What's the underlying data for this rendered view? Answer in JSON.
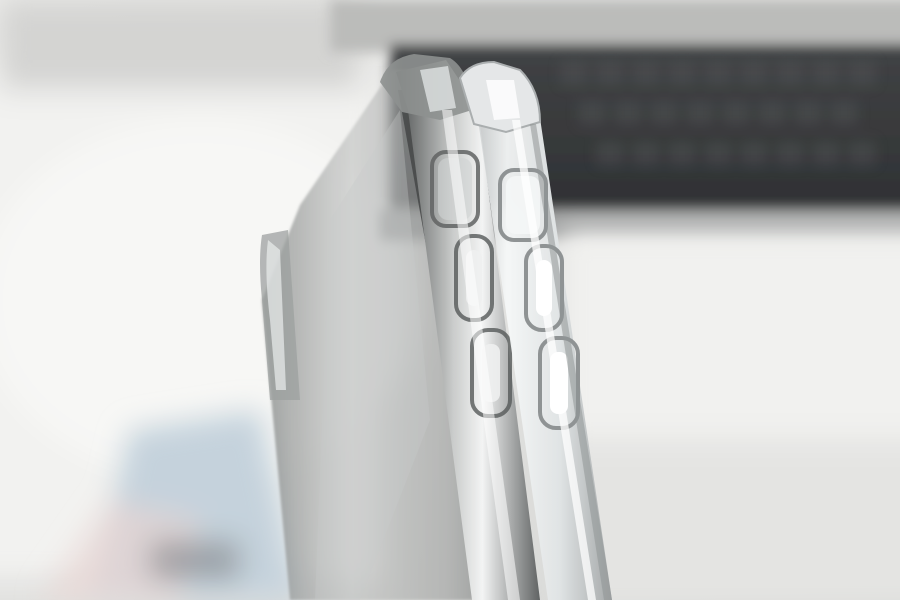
{
  "photo": {
    "subject_icon": "phone-case-icon",
    "colors": {
      "background_light": "#e8e8e6",
      "background_mid": "#cfd0ce",
      "keyboard_dark": "#2e3032",
      "case_smoke": "#8f918f",
      "case_clear": "#eef1f2",
      "highlight": "#ffffff",
      "print_blue": "#b9cbd8"
    }
  }
}
